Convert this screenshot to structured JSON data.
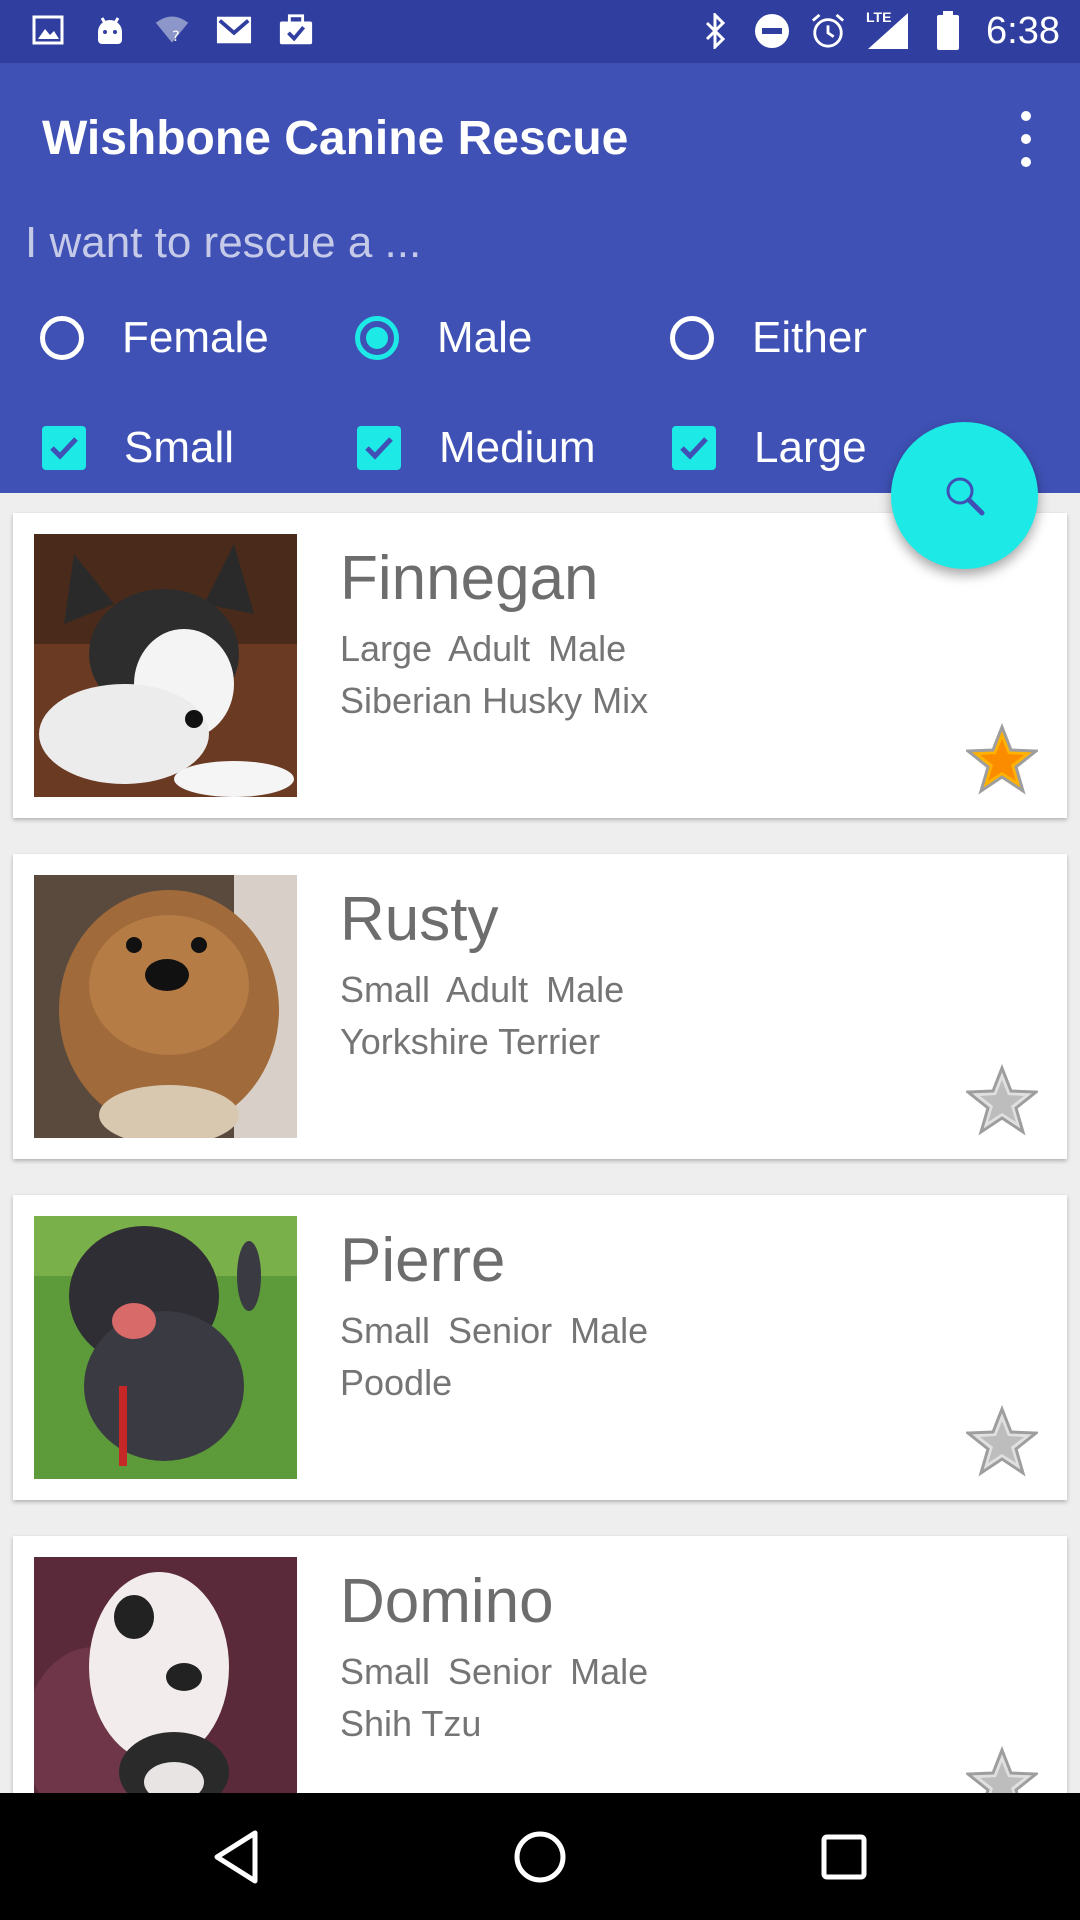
{
  "status_bar": {
    "time": "6:38",
    "network": "LTE",
    "left_icons": [
      "image-icon",
      "android-icon",
      "wifi-unknown-icon",
      "gmail-icon",
      "briefcase-check-icon"
    ],
    "right_icons": [
      "bluetooth-icon",
      "do-not-disturb-icon",
      "alarm-icon",
      "signal-icon",
      "battery-icon"
    ]
  },
  "app_bar": {
    "title": "Wishbone Canine Rescue",
    "menu_icon": "overflow-menu-icon"
  },
  "filters": {
    "prompt": "I want to rescue a ...",
    "gender": {
      "options": [
        "Female",
        "Male",
        "Either"
      ],
      "selected": "Male"
    },
    "size": {
      "options": [
        "Small",
        "Medium",
        "Large"
      ],
      "checked": [
        true,
        true,
        true
      ]
    }
  },
  "fab": {
    "icon": "search-icon",
    "color": "#1de9e6"
  },
  "colors": {
    "primary": "#3f51b5",
    "primary_dark": "#303f9f",
    "accent": "#1de9e6",
    "favorite": "#ff9800"
  },
  "dogs": [
    {
      "name": "Finnegan",
      "attrs": "Large  Adult  Male",
      "breed": "Siberian Husky Mix",
      "favorite": true
    },
    {
      "name": "Rusty",
      "attrs": "Small  Adult  Male",
      "breed": "Yorkshire Terrier",
      "favorite": false
    },
    {
      "name": "Pierre",
      "attrs": "Small  Senior  Male",
      "breed": "Poodle",
      "favorite": false
    },
    {
      "name": "Domino",
      "attrs": "Small  Senior  Male",
      "breed": "Shih Tzu",
      "favorite": false
    }
  ],
  "nav_bar": {
    "buttons": [
      "back-icon",
      "home-icon",
      "recents-icon"
    ]
  }
}
